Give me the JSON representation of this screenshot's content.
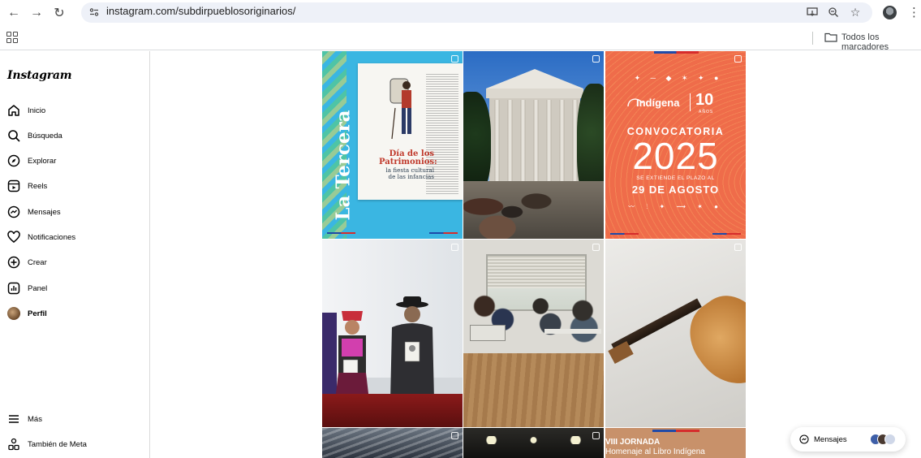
{
  "browser": {
    "url": "instagram.com/subdirpueblosoriginarios/",
    "bookmarks_folder_label": "Todos los marcadores"
  },
  "sidebar": {
    "logo": "Instagram",
    "items": [
      {
        "label": "Inicio",
        "icon": "home-icon"
      },
      {
        "label": "Búsqueda",
        "icon": "search-icon"
      },
      {
        "label": "Explorar",
        "icon": "compass-icon"
      },
      {
        "label": "Reels",
        "icon": "reels-icon"
      },
      {
        "label": "Mensajes",
        "icon": "messenger-icon"
      },
      {
        "label": "Notificaciones",
        "icon": "heart-icon"
      },
      {
        "label": "Crear",
        "icon": "plus-square-icon"
      },
      {
        "label": "Panel",
        "icon": "dashboard-icon"
      },
      {
        "label": "Perfil",
        "icon": "profile-avatar"
      }
    ],
    "bottom_items": [
      {
        "label": "Más",
        "icon": "hamburger-icon"
      },
      {
        "label": "También de Meta",
        "icon": "meta-threads-icon"
      }
    ]
  },
  "posts": {
    "t1": {
      "brand": "La Tercera",
      "headline": "Día de los Patrimonios:",
      "subhead": "la fiesta cultural de las infancias"
    },
    "t3": {
      "title": "Indígena",
      "ten": "10",
      "anos": "AÑOS",
      "convocatoria": "CONVOCATORIA",
      "year": "2025",
      "plazo": "SE EXTIENDE EL PLAZO AL",
      "fecha": "29 DE AGOSTO"
    },
    "t9": {
      "jornada": "VIII JORNADA",
      "homenaje": "Homenaje al Libro Indígena"
    }
  },
  "messages_pill": {
    "label": "Mensajes"
  },
  "colors": {
    "accent_orange": "#ef6c4a",
    "sky_blue": "#3ab6e2",
    "chile_blue": "#1f4aa8",
    "chile_red": "#d62c2c"
  }
}
